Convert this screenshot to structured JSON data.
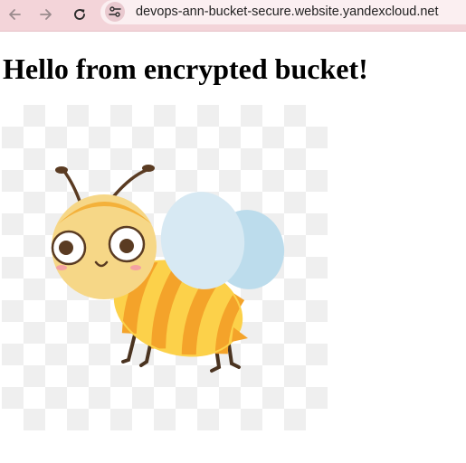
{
  "browser": {
    "url": "devops-ann-bucket-secure.website.yandexcloud.net",
    "back_icon": "arrow-left-icon",
    "forward_icon": "arrow-right-icon",
    "reload_icon": "reload-icon",
    "site_info_icon": "tune-icon"
  },
  "page": {
    "heading": "Hello from encrypted bucket!",
    "image": {
      "subject": "bee-illustration",
      "background": "transparency-checkerboard"
    }
  },
  "colors": {
    "toolbar": "#f3d4d9",
    "omnibox": "#fbeff1",
    "bee_yellow": "#fcd14a",
    "bee_orange": "#f4a32a",
    "wing_blue": "#c5e0ef"
  }
}
